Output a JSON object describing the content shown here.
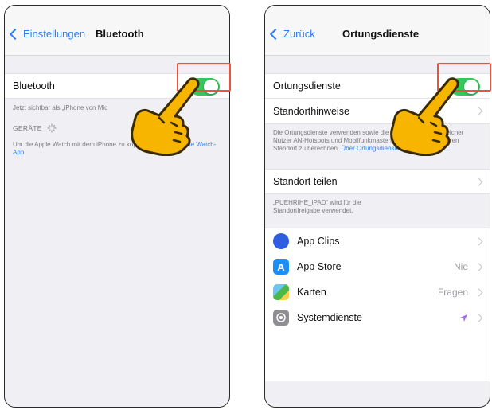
{
  "left": {
    "nav": {
      "back_label": "Einstellungen",
      "title": "Bluetooth"
    },
    "bluetooth_row": {
      "label": "Bluetooth",
      "toggle_on": true
    },
    "visible_note": "Jetzt sichtbar als „iPhone von Mic",
    "devices_header": "GERÄTE",
    "watch_note": "Um die Apple Watch mit dem iPhone zu koppeln, öffne die",
    "watch_link": "Apple Watch-App",
    "watch_note_end": "."
  },
  "right": {
    "nav": {
      "back_label": "Zurück",
      "title": "Ortungsdienste"
    },
    "location_row": {
      "label": "Ortungsdienste",
      "toggle_on": true
    },
    "hints_row": {
      "label": "Standorthinweise"
    },
    "info_note": "Die Ortungsdienste verwenden             sowie die Standortdaten zahlreicher Nutzer         AN-Hotspots und Mobilfunkmasten, um deinen ungefähren Standort zu berechnen.",
    "info_link": "Über Ortungsdienste & Datenschutz ...",
    "share_row": {
      "label": "Standort teilen"
    },
    "share_note": "„PUEHRIHE_IPAD“ wird für die Standortfreigabe verwendet.",
    "apps": [
      {
        "icon": "app-clips-icon",
        "label": "App Clips",
        "value": "",
        "color": "#2f5fe0"
      },
      {
        "icon": "app-store-icon",
        "label": "App Store",
        "value": "Nie",
        "color": "#1c8ef5"
      },
      {
        "icon": "maps-icon",
        "label": "Karten",
        "value": "Fragen",
        "color": "#4cb84c"
      },
      {
        "icon": "settings-gear-icon",
        "label": "Systemdienste",
        "value": "",
        "color": "#8e8e93"
      }
    ]
  },
  "colors": {
    "toggle_on": "#34c759",
    "highlight": "#e8553c",
    "link": "#2f7cf6",
    "hand": "#f7b500"
  }
}
